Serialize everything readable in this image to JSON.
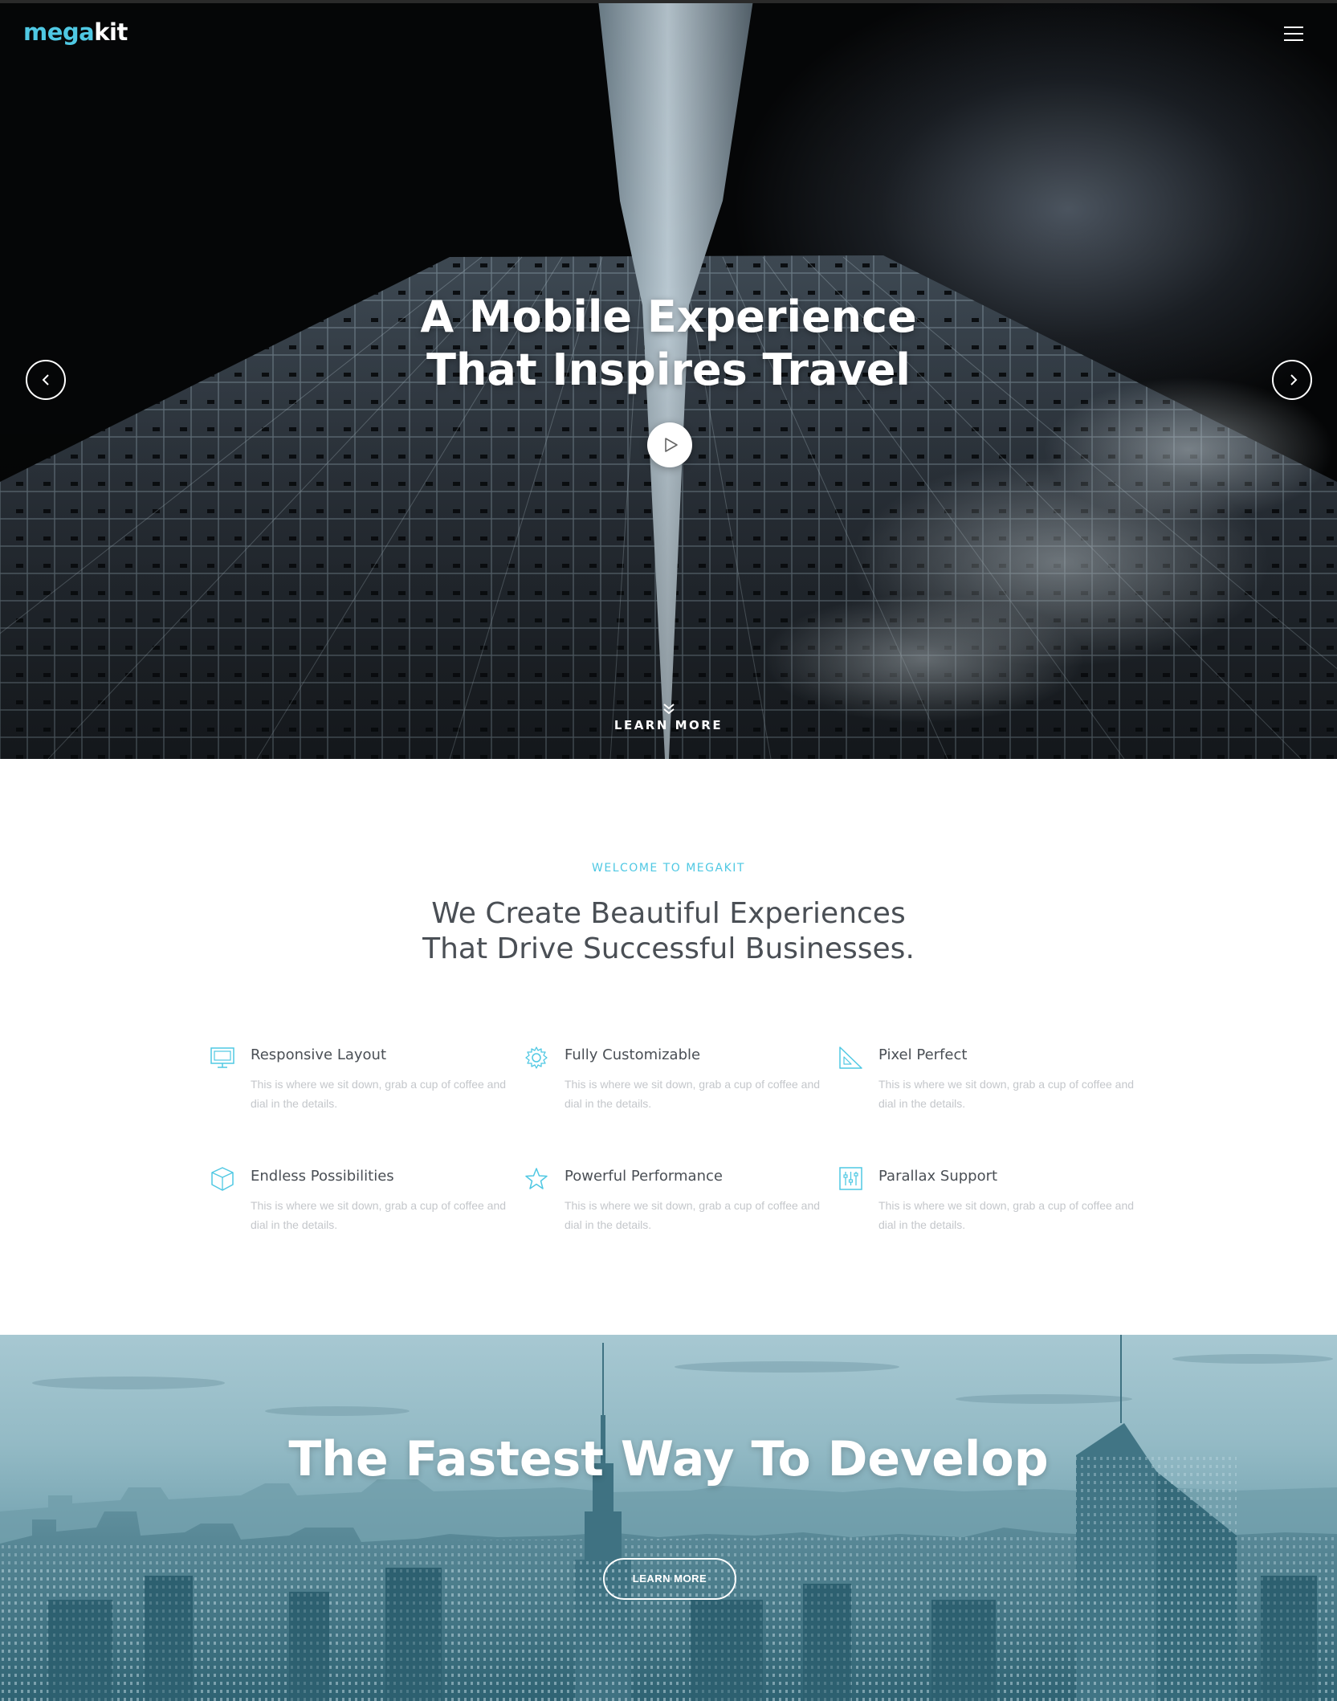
{
  "header": {
    "logo_part_a": "mega",
    "logo_part_b": "kit",
    "menu_icon": "hamburger-icon"
  },
  "hero": {
    "title_line1": "A Mobile Experience",
    "title_line2": "That Inspires Travel",
    "play_icon": "play-icon",
    "prev_icon": "chevron-left-icon",
    "next_icon": "chevron-right-icon",
    "learn_more": "LEARN MORE"
  },
  "intro": {
    "eyebrow": "WELCOME TO MEGAKIT",
    "headline_line1": "We Create Beautiful Experiences",
    "headline_line2": "That Drive Successful Businesses."
  },
  "features": [
    {
      "title": "Responsive Layout",
      "desc": "This is where we sit down, grab a cup of coffee and dial in the details.",
      "icon": "monitor-icon"
    },
    {
      "title": "Fully Customizable",
      "desc": "This is where we sit down, grab a cup of coffee and dial in the details.",
      "icon": "gear-icon"
    },
    {
      "title": "Pixel Perfect",
      "desc": "This is where we sit down, grab a cup of coffee and dial in the details.",
      "icon": "set-square-icon"
    },
    {
      "title": "Endless Possibilities",
      "desc": "This is where we sit down, grab a cup of coffee and dial in the details.",
      "icon": "cube-icon"
    },
    {
      "title": "Powerful Performance",
      "desc": "This is where we sit down, grab a cup of coffee and dial in the details.",
      "icon": "star-icon"
    },
    {
      "title": "Parallax Support",
      "desc": "This is where we sit down, grab a cup of coffee and dial in the details.",
      "icon": "sliders-icon"
    }
  ],
  "cta": {
    "title": "The Fastest Way To Develop",
    "button": "LEARN MORE"
  },
  "colors": {
    "accent": "#4fc8e3",
    "heading": "#4a4f55",
    "muted": "#c4c7cb",
    "cta_tint": "#7aaab7"
  }
}
